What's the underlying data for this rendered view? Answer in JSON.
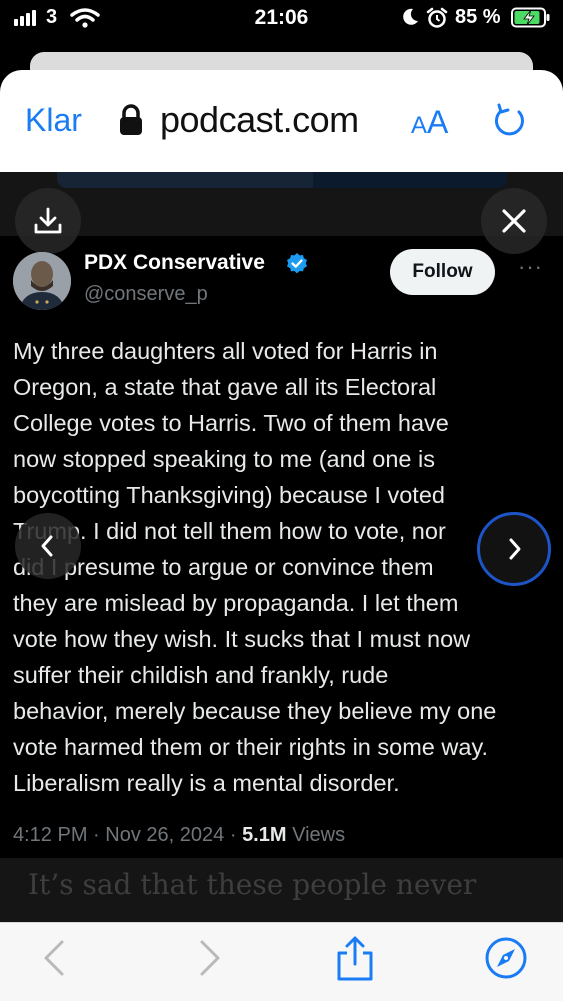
{
  "status_bar": {
    "carrier": "3",
    "time": "21:06",
    "battery_percent": "85 %",
    "icons": [
      "signal-icon",
      "wifi-icon",
      "moon-icon",
      "alarm-icon",
      "battery-charging-icon"
    ]
  },
  "browser": {
    "done_label": "Klar",
    "domain": "podcast.com",
    "text_size_small": "A",
    "text_size_large": "A"
  },
  "tweet": {
    "author_name": "PDX Conservative",
    "handle": "@conserve_p",
    "follow_label": "Follow",
    "more_label": "···",
    "text": "My three daughters all voted for Harris in\nOregon, a state that gave all its Electoral\nCollege votes to Harris. Two of them have\nnow stopped speaking to me (and one is\nboycotting Thanksgiving) because I voted\nTrump. I did not tell them how to vote, nor\ndid I presume to argue or convince them\nthey are mislead by propaganda. I let them\nvote how they wish. It sucks that I must now\nsuffer their childish and frankly, rude\nbehavior, merely because they believe my one\nvote harmed them or their rights in some way.\nLiberalism really is a mental disorder.",
    "time": "4:12 PM",
    "date": "Nov 26, 2024",
    "views_count": "5.1M",
    "views_label": "Views",
    "separator": "·"
  },
  "article": {
    "visible_text": "It’s sad that these people never"
  },
  "colors": {
    "accent_blue": "#1a7cf5",
    "twitter_blue": "#1d9bf0",
    "tweet_text": "#e7e9ea",
    "muted": "#71767b"
  }
}
